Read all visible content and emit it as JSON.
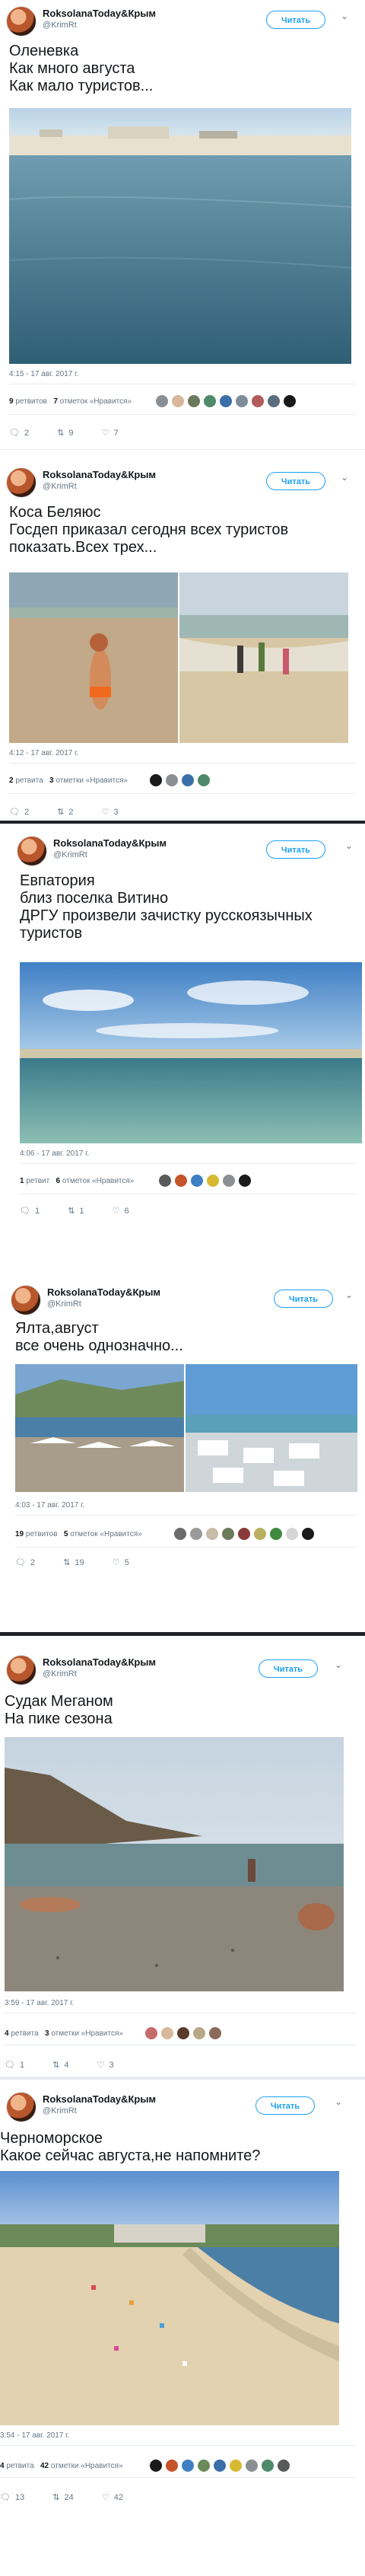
{
  "accent": "#1da1f2",
  "tweets": [
    {
      "username": "RoksolanaToday&Крым",
      "handle": "@KrimRt",
      "follow": "Читать",
      "text": "Оленевка\nКак много августа\nКак мало туристов...",
      "timestamp": "4:15 - 17 авг. 2017 г.",
      "retweets": "9",
      "retweets_label": "ретвитов",
      "likes": "7",
      "likes_label": "отметок «Нравится»",
      "reply_count": "2",
      "retweet_count": "9",
      "like_count": "7"
    },
    {
      "username": "RoksolanaToday&Крым",
      "handle": "@KrimRt",
      "follow": "Читать",
      "text": "Коса Беляюс\nГосдеп приказал сегодня всех туристов показать.Всех трех...",
      "timestamp": "4:12 - 17 авг. 2017 г.",
      "retweets": "2",
      "retweets_label": "ретвита",
      "likes": "3",
      "likes_label": "отметки «Нравится»",
      "reply_count": "2",
      "retweet_count": "2",
      "like_count": "3"
    },
    {
      "username": "RoksolanaToday&Крым",
      "handle": "@KrimRt",
      "follow": "Читать",
      "text": "Евпатория\nблиз поселка Витино\nДРГУ произвели зачистку русскоязычных туристов",
      "timestamp": "4:06 - 17 авг. 2017 г.",
      "retweets": "1",
      "retweets_label": "ретвит",
      "likes": "6",
      "likes_label": "отметок «Нравится»",
      "reply_count": "1",
      "retweet_count": "1",
      "like_count": "6"
    },
    {
      "username": "RoksolanaToday&Крым",
      "handle": "@KrimRt",
      "follow": "Читать",
      "text": "Ялта,август\nвсе очень однозначно...",
      "timestamp": "4:03 - 17 авг. 2017 г.",
      "retweets": "19",
      "retweets_label": "ретвитов",
      "likes": "5",
      "likes_label": "отметок «Нравится»",
      "reply_count": "2",
      "retweet_count": "19",
      "like_count": "5"
    },
    {
      "username": "RoksolanaToday&Крым",
      "handle": "@KrimRt",
      "follow": "Читать",
      "text": "Судак Меганом\nНа пике  сезона",
      "timestamp": "3:59 - 17 авг. 2017 г.",
      "retweets": "4",
      "retweets_label": "ретвита",
      "likes": "3",
      "likes_label": "отметки «Нравится»",
      "reply_count": "1",
      "retweet_count": "4",
      "like_count": "3"
    },
    {
      "username": "RoksolanaToday&Крым",
      "handle": "@KrimRt",
      "follow": "Читать",
      "text": "Черноморское\nКакое сейчас августа,не напомните?",
      "timestamp": "3:54 - 17 авг. 2017 г.",
      "retweets": "4",
      "retweets_label": "ретвита",
      "likes": "42",
      "likes_label": "отметки «Нравится»",
      "reply_count": "13",
      "retweet_count": "24",
      "like_count": "42"
    }
  ],
  "icons": {
    "reply": "reply-icon",
    "retweet": "retweet-icon",
    "like": "heart-icon",
    "chevron": "chevron-down-icon"
  }
}
